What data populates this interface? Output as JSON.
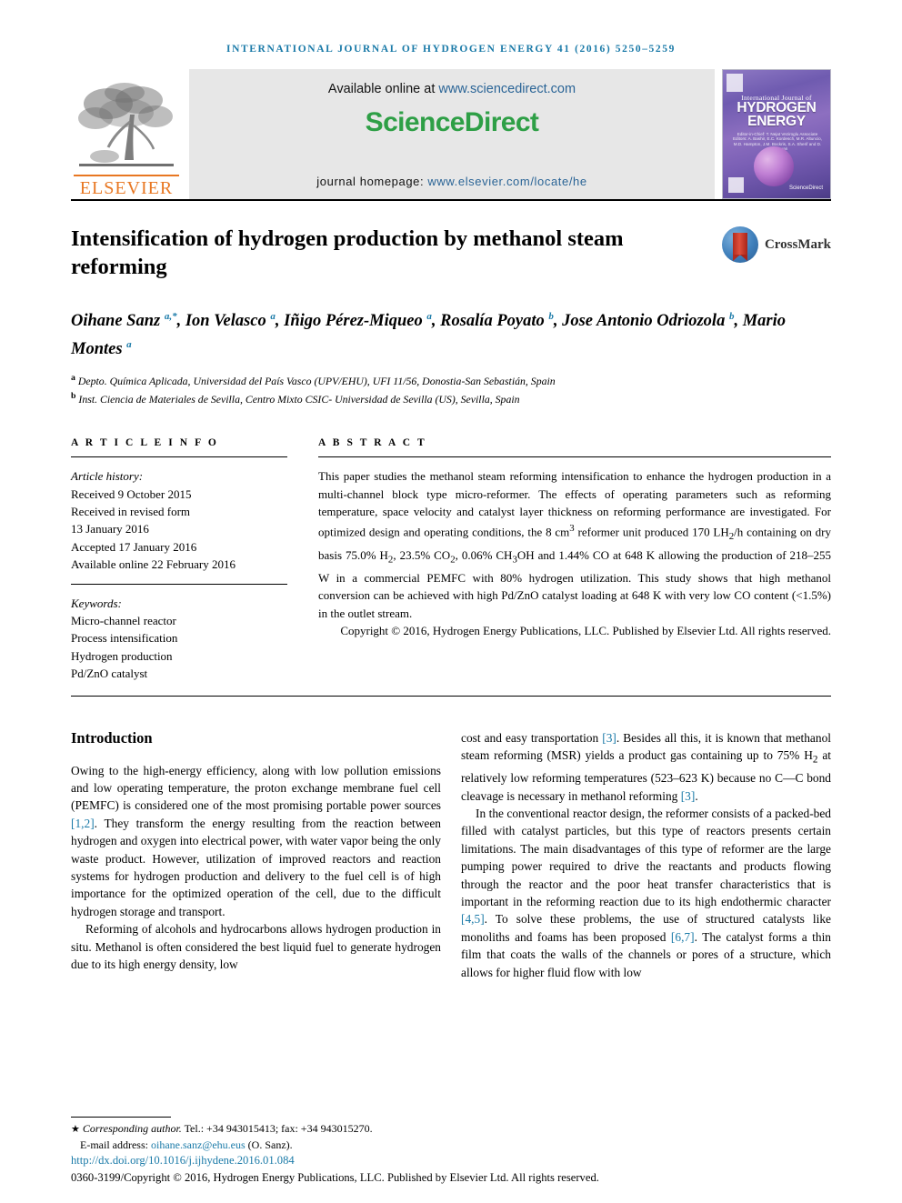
{
  "running_head": "INTERNATIONAL JOURNAL OF HYDROGEN ENERGY 41 (2016) 5250–5259",
  "masthead": {
    "elsevier_wordmark": "ELSEVIER",
    "available_prefix": "Available online at ",
    "available_url": "www.sciencedirect.com",
    "sciencedirect_science": "Science",
    "sciencedirect_direct": "Direct",
    "homepage_prefix": "journal homepage: ",
    "homepage_url": "www.elsevier.com/locate/he",
    "cover": {
      "small_title": "International Journal of",
      "big_title_line1": "HYDROGEN",
      "big_title_line2": "ENERGY",
      "editors": "Editor-in-Chief: T. Nejat Veziroglu   Associate Editors: A. Bashir, E.C. Kordesch, M.R. Altuncio, M.D. Hampton, J.M. Bockris, S.A. Sherif and D. Vasudevan",
      "brand": "ScienceDirect"
    }
  },
  "article": {
    "title": "Intensification of hydrogen production by methanol steam reforming",
    "crossmark_label": "CrossMark",
    "authors_html": "Oihane Sanz <sup class=\"aff\">a,*</sup>, Ion Velasco <sup class=\"aff\">a</sup>, Iñigo Pérez-Miqueo <sup class=\"aff\">a</sup>, Rosalía Poyato <sup class=\"aff\">b</sup>, Jose Antonio Odriozola <sup class=\"aff\">b</sup>, Mario Montes <sup class=\"aff\">a</sup>",
    "affiliations": [
      {
        "marker": "a",
        "text": "Depto. Química Aplicada, Universidad del País Vasco (UPV/EHU), UFI 11/56, Donostia-San Sebastián, Spain"
      },
      {
        "marker": "b",
        "text": "Inst. Ciencia de Materiales de Sevilla, Centro Mixto CSIC- Universidad de Sevilla (US), Sevilla, Spain"
      }
    ]
  },
  "info": {
    "heading": "A R T I C L E   I N F O",
    "history_label": "Article history:",
    "history": [
      "Received 9 October 2015",
      "Received in revised form",
      "13 January 2016",
      "Accepted 17 January 2016",
      "Available online 22 February 2016"
    ],
    "keywords_label": "Keywords:",
    "keywords": [
      "Micro-channel reactor",
      "Process intensification",
      "Hydrogen production",
      "Pd/ZnO catalyst"
    ]
  },
  "abstract": {
    "heading": "A B S T R A C T",
    "body_html": "This paper studies the methanol steam reforming intensification to enhance the hydrogen production in a multi-channel block type micro-reformer. The effects of operating parameters such as reforming temperature, space velocity and catalyst layer thickness on reforming performance are investigated. For optimized design and operating conditions, the 8 cm<sup>3</sup> reformer unit produced 170 LH<sub>2</sub>/h containing on dry basis 75.0% H<sub>2</sub>, 23.5% CO<sub>2</sub>, 0.06% CH<sub>3</sub>OH and 1.44% CO at 648 K allowing the production of 218–255 W in a commercial PEMFC with 80% hydrogen utilization. This study shows that high methanol conversion can be achieved with high Pd/ZnO catalyst loading at 648 K with very low CO content (&lt;1.5%) in the outlet stream.",
    "copyright": "Copyright © 2016, Hydrogen Energy Publications, LLC. Published by Elsevier Ltd. All rights reserved."
  },
  "body": {
    "section_heading": "Introduction",
    "left_paragraphs_html": [
      "Owing to the high-energy efficiency, along with low pollution emissions and low operating temperature, the proton exchange membrane fuel cell (PEMFC) is considered one of the most promising portable power sources <a class=\"cite\" href=\"#\">[1,2]</a>. They transform the energy resulting from the reaction between hydrogen and oxygen into electrical power, with water vapor being the only waste product. However, utilization of improved reactors and reaction systems for hydrogen production and delivery to the fuel cell is of high importance for the optimized operation of the cell, due to the difficult hydrogen storage and transport.",
      "Reforming of alcohols and hydrocarbons allows hydrogen production in situ. Methanol is often considered the best liquid fuel to generate hydrogen due to its high energy density, low"
    ],
    "right_paragraphs_html": [
      "cost and easy transportation <a class=\"cite\" href=\"#\">[3]</a>. Besides all this, it is known that methanol steam reforming (MSR) yields a product gas containing up to 75% H<sub>2</sub> at relatively low reforming temperatures (523–623 K) because no C—C bond cleavage is necessary in methanol reforming <a class=\"cite\" href=\"#\">[3]</a>.",
      "In the conventional reactor design, the reformer consists of a packed-bed filled with catalyst particles, but this type of reactors presents certain limitations. The main disadvantages of this type of reformer are the large pumping power required to drive the reactants and products flowing through the reactor and the poor heat transfer characteristics that is important in the reforming reaction due to its high endothermic character <a class=\"cite\" href=\"#\">[4,5]</a>. To solve these problems, the use of structured catalysts like monoliths and foams has been proposed <a class=\"cite\" href=\"#\">[6,7]</a>. The catalyst forms a thin film that coats the walls of the channels or pores of a structure, which allows for higher fluid flow with low"
    ]
  },
  "footer": {
    "corresponding_html": "<i>Corresponding author.</i> Tel.: +34 943015413; fax: +34 943015270.",
    "email_label": "E-mail address: ",
    "email": "oihane.sanz@ehu.eus",
    "email_suffix": " (O. Sanz).",
    "doi": "http://dx.doi.org/10.1016/j.ijhydene.2016.01.084",
    "issn_line": "0360-3199/Copyright © 2016, Hydrogen Energy Publications, LLC. Published by Elsevier Ltd. All rights reserved."
  }
}
